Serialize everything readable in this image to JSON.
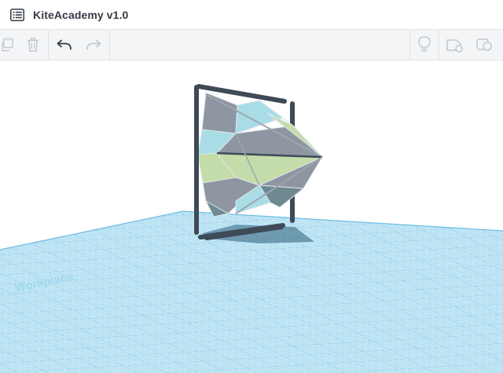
{
  "app": {
    "title": "KiteAcademy v1.0"
  },
  "icons": {
    "menu": "list-menu-icon",
    "copy": "copy-icon",
    "delete": "trash-icon",
    "undo": "undo-arrow-icon",
    "redo": "redo-arrow-icon",
    "hint": "lightbulb-icon",
    "notes": "note-shape-icon",
    "comment": "comment-shape-icon"
  },
  "workplane": {
    "grid_color": "#7cc8e8",
    "grid_bg": "#b9e3f3",
    "label": "Workplane"
  },
  "model": {
    "frame_color": "#3f4a57",
    "panel_colors": [
      "#8e96a1",
      "#a8dde6",
      "#c4dca9",
      "#6e8a90"
    ]
  },
  "colors": {
    "toolbar_bg": "#f4f5f6",
    "icon_active": "#343b44",
    "icon_disabled": "#c3c8ce"
  }
}
